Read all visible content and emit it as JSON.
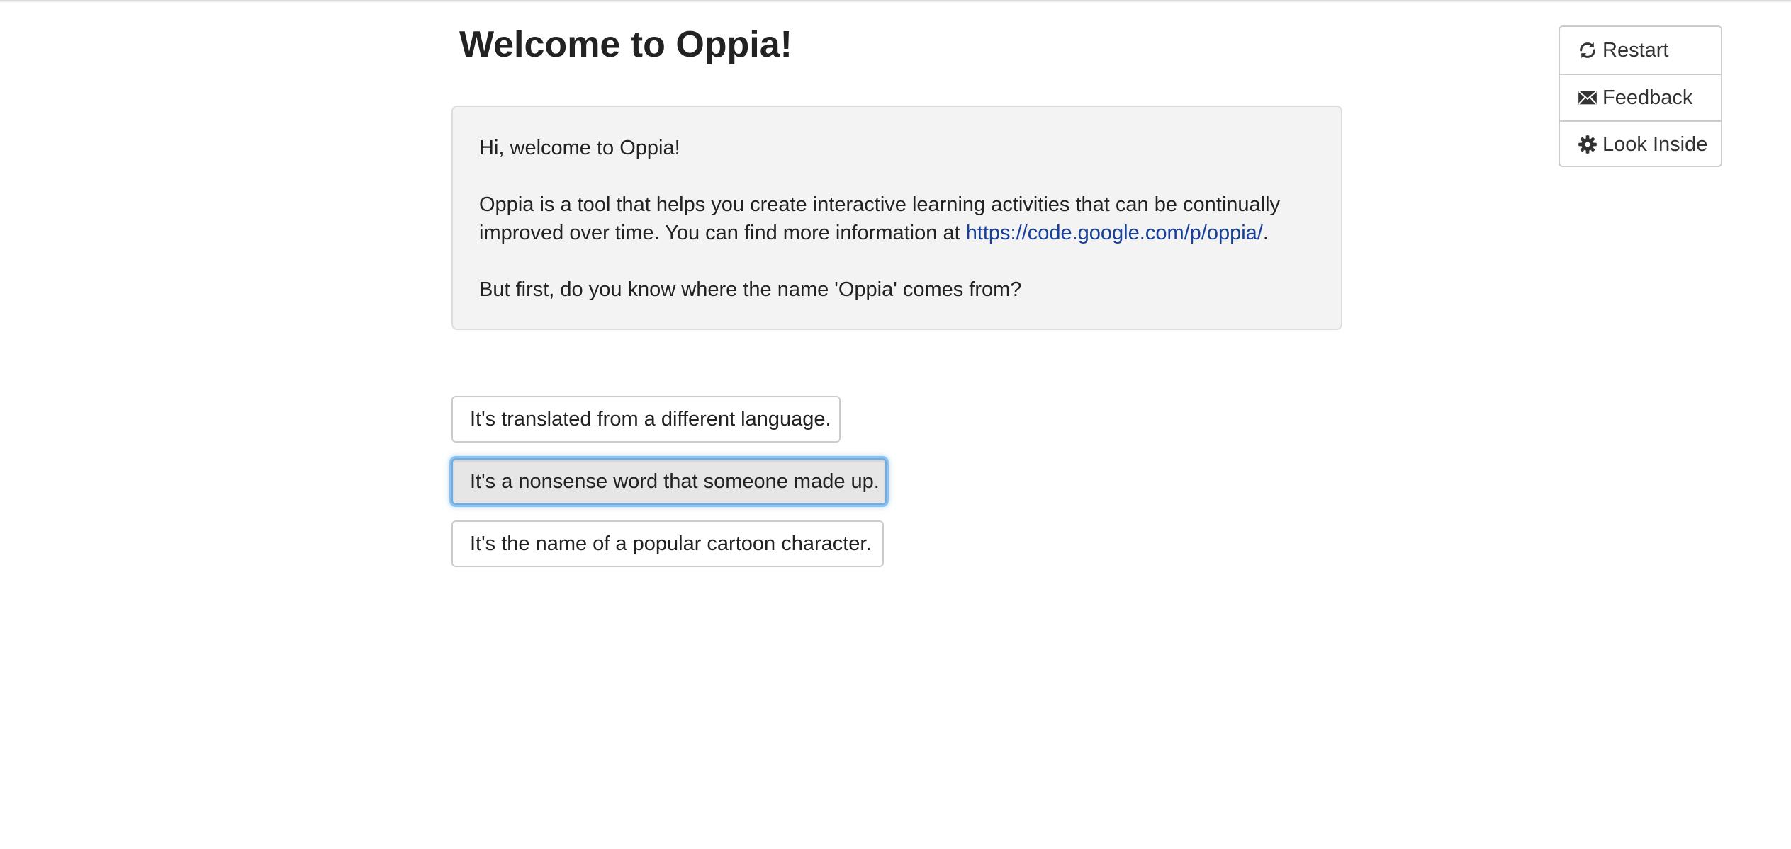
{
  "page": {
    "title": "Welcome to Oppia!"
  },
  "content": {
    "greeting": "Hi, welcome to Oppia!",
    "intro_text": "Oppia is a tool that helps you create interactive learning activities that can be continually improved over time. You can find more information at ",
    "link_text": "https://code.google.com/p/oppia/",
    "after_link": ".",
    "question": "But first, do you know where the name 'Oppia' comes from?"
  },
  "choices": [
    {
      "label": "It's translated from a different language."
    },
    {
      "label": "It's a nonsense word that someone made up.",
      "state": "focused"
    },
    {
      "label": "It's the name of a popular cartoon character."
    }
  ],
  "side_menu": {
    "items": [
      {
        "label": "Restart",
        "icon": "refresh-icon"
      },
      {
        "label": "Feedback",
        "icon": "envelope-icon"
      },
      {
        "label": "Look Inside",
        "icon": "gear-icon"
      }
    ]
  },
  "colors": {
    "link": "#16409c",
    "focus_ring": "#66afe9",
    "content_bg": "#f3f3f3"
  }
}
